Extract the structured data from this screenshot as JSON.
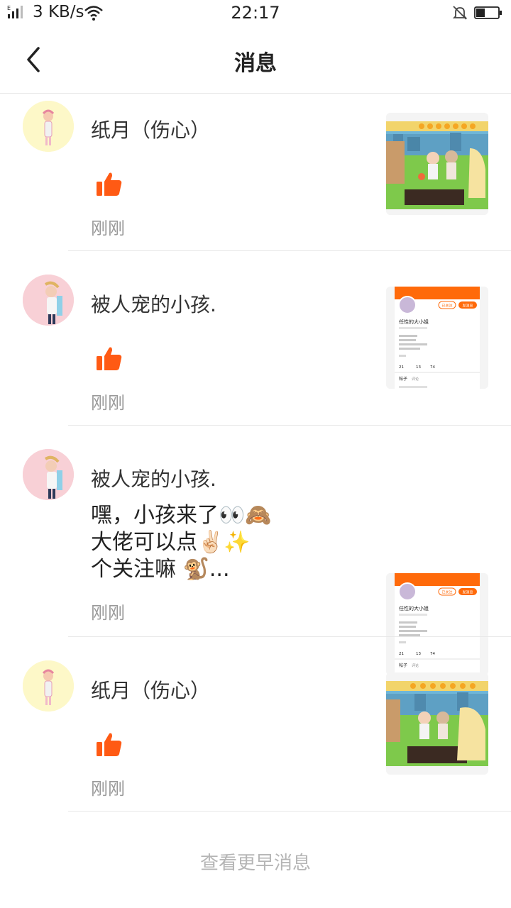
{
  "status_bar": {
    "network_label": "E",
    "speed": "3 KB/s",
    "time": "22:17",
    "icons": [
      "signal-icon",
      "wifi-icon",
      "bell-muted-icon",
      "battery-icon"
    ],
    "battery_level": 0.4
  },
  "header": {
    "title": "消息",
    "back_icon": "chevron-left-icon"
  },
  "messages": [
    {
      "user": "纸月（伤心）",
      "type": "like",
      "time": "刚刚",
      "thumb": "game-scene"
    },
    {
      "user": "被人宠的小孩.",
      "type": "like",
      "time": "刚刚",
      "thumb": "profile-page"
    },
    {
      "user": "被人宠的小孩.",
      "type": "comment",
      "comment": "嘿，小孩来了👀🙈\n大佬可以点✌🏻✨\n个关注嘛 🐒...",
      "time": "刚刚",
      "thumb": "profile-page"
    },
    {
      "user": "纸月（伤心）",
      "type": "like",
      "time": "刚刚",
      "thumb": "game-scene"
    }
  ],
  "profile_thumb": {
    "name": "任性的大小姐",
    "follow_btn": "已关注",
    "msg_btn": "发消息",
    "stats": [
      "21",
      "13",
      "74"
    ],
    "posts_label": "帖子",
    "comments_label": "评论"
  },
  "footer": {
    "more_label": "查看更早消息"
  },
  "colors": {
    "accent": "#ff6a0a",
    "like": "#ff5a14",
    "divider": "#e8e8e8",
    "muted": "#9a9a9a"
  }
}
